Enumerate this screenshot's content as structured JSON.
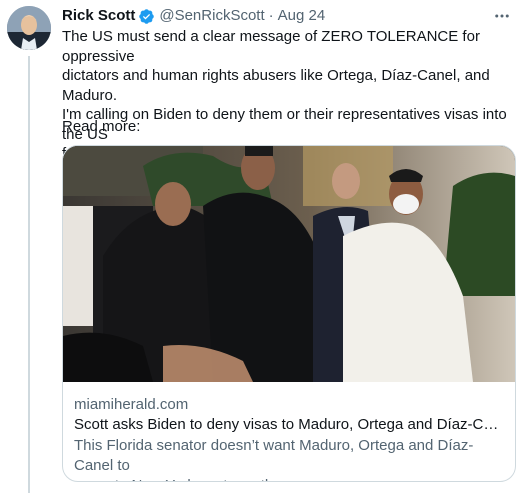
{
  "tweet": {
    "author_name": "Rick Scott",
    "author_handle": "@SenRickScott",
    "separator": "·",
    "date": "Aug 24",
    "more_icon": "more-horizontal-icon",
    "verified_icon": "verified-badge-icon",
    "text": "The US must send a clear message of ZERO TOLERANCE for oppressive\ndictators and human rights abusers like Ortega, Díaz-Canel, and Maduro.\nI'm calling on Biden to deny them or their representatives visas into the US\nfor the UN General Assembly.",
    "read_more": "Read more:"
  },
  "card": {
    "domain": "miamiherald.com",
    "title": "Scott asks Biden to deny visas to Maduro, Ortega and Díaz-Canel to a...",
    "description": "This Florida senator doesn’t want Maduro, Ortega and Díaz-Canel to\ncome to New York next month"
  },
  "colors": {
    "text_primary": "#0f1419",
    "text_secondary": "#536471",
    "verified_blue": "#1d9bf0",
    "border": "#cfd9de"
  }
}
